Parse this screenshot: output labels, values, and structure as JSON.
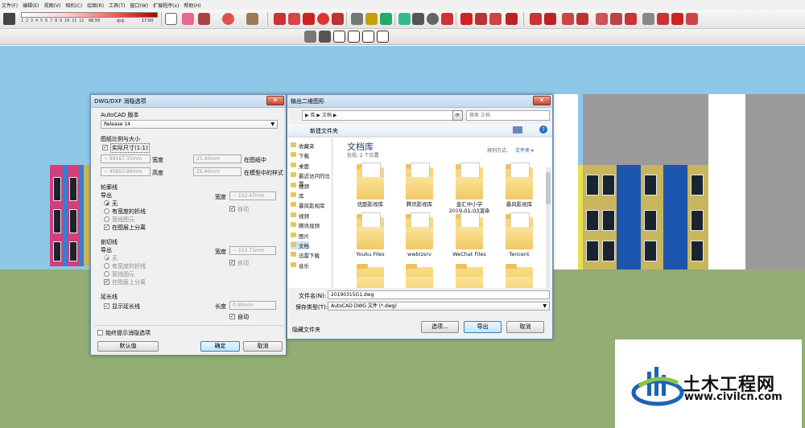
{
  "menubar": [
    "文件(F)",
    "编辑(E)",
    "视图(V)",
    "相机(C)",
    "绘图(R)",
    "工具(T)",
    "窗口(W)",
    "扩展程序(x)",
    "帮助(H)"
  ],
  "shadow": {
    "ticks": "1 2 3 4 5 6 7 8 9 10 11 12",
    "time_start": "06:55",
    "noon": "中午",
    "time_end": "17:00"
  },
  "dxf_dialog": {
    "title": "DWG/DXF 消隐选项",
    "close": "✕",
    "autocad_version_label": "AutoCAD 版本",
    "autocad_version_value": "Release 14",
    "scale_label": "图纸比例与大小",
    "actual_size_label": "实际尺寸(1:1)",
    "width_model": "~ 99167.35mm",
    "width_label": "宽度",
    "width_paper": "25.40mm",
    "in_paper_label": "在图纸中",
    "height_model": "~ 45650.89mm",
    "height_label": "高度",
    "height_paper": "25.40mm",
    "in_model_label": "在模型中的样式",
    "outline": {
      "title": "轮廓线",
      "export": "导出",
      "width_label": "宽度",
      "width_value": "~ 102.47mm",
      "none": "无",
      "with_width": "有宽度的折线",
      "wide_entity": "宽线图元",
      "auto": "自动",
      "separate": "在图层上分离"
    },
    "section": {
      "title": "剖切线",
      "export": "导出",
      "width_label": "宽度",
      "width_value": "~ 153.71mm",
      "none": "无",
      "with_width": "有宽度的折线",
      "wide_entity": "宽线图元",
      "auto": "自动",
      "separate": "在图层上分离"
    },
    "extension": {
      "title": "延长线",
      "show": "显示延长线",
      "length_label": "长度",
      "length_value": "0.00mm",
      "auto": "自动"
    },
    "always_prompt": "始终提示消隐选项",
    "defaults_button": "默认值",
    "ok_button": "确定",
    "cancel_button": "取消"
  },
  "file_dialog": {
    "title": "输出二维图形",
    "close": "✕",
    "breadcrumb": "▶ 库 ▶ 文档 ▶",
    "search_placeholder": "搜索 文档",
    "new_folder": "新建文件夹",
    "nav": [
      "收藏夹",
      "下载",
      "桌面",
      "最近访问的位置",
      "视频",
      "库",
      "暴风影视库",
      "视频",
      "腾讯视频",
      "图片",
      "文档",
      "迅雷下载",
      "音乐"
    ],
    "library_title": "文档库",
    "library_sub": "包括: 2 个位置",
    "arrange_label": "排列方式:",
    "arrange_value": "文件夹 ▾",
    "files": [
      {
        "name": "优酷影视库"
      },
      {
        "name": "腾讯影视库"
      },
      {
        "name": "金汇中小学\n2019-01-03渲染"
      },
      {
        "name": "暴风影视库"
      },
      {
        "name": "Youku Files"
      },
      {
        "name": "wwbizsrv"
      },
      {
        "name": "WeChat Files"
      },
      {
        "name": "Tencent"
      }
    ],
    "filename_label": "文件名(N):",
    "filename_value": "20190315G1.dwg",
    "type_label": "保存类型(T):",
    "type_value": "AutoCAD DWG 文件 (*.dwg)",
    "hide_folders": "隐藏文件夹",
    "options_button": "选项...",
    "export_button": "导出",
    "cancel_button": "取消"
  },
  "watermark": {
    "title": "土木工程网",
    "url": "www.civilcn.com"
  },
  "colors": {
    "sky": "#8ec7e8",
    "ground": "#93ad74",
    "accent": "#1b62b8"
  }
}
